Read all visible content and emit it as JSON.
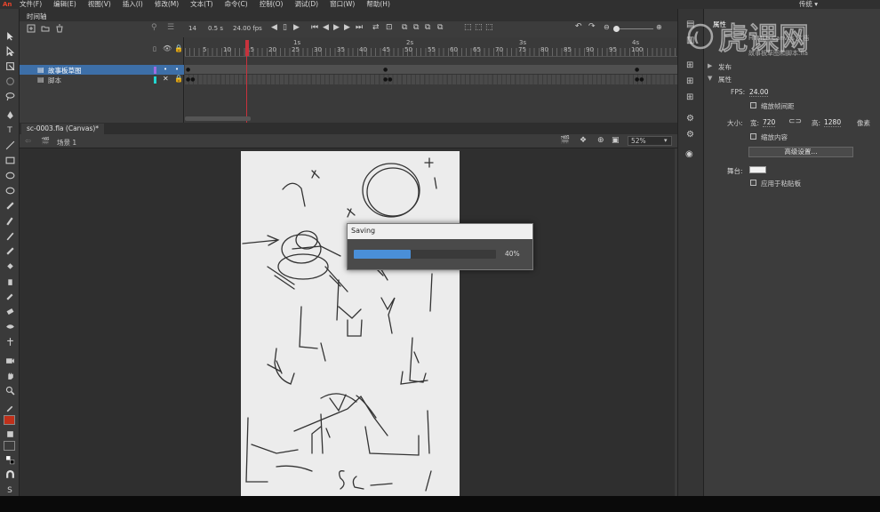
{
  "menubar": {
    "logo": "An",
    "items": [
      "文件(F)",
      "编辑(E)",
      "视图(V)",
      "插入(I)",
      "修改(M)",
      "文本(T)",
      "命令(C)",
      "控制(O)",
      "调试(D)",
      "窗口(W)",
      "帮助(H)"
    ],
    "workspace": "传统 ▾"
  },
  "timeline": {
    "panel_title": "时间轴",
    "frame": "14",
    "time": "0.5 s",
    "fps": "24.00 fps",
    "seconds": [
      "1s",
      "2s",
      "3s",
      "4s"
    ],
    "ruler": [
      "5",
      "10",
      "15",
      "20",
      "25",
      "30",
      "35",
      "40",
      "45",
      "50",
      "55",
      "60",
      "65",
      "70",
      "75",
      "80",
      "85",
      "90",
      "95",
      "100"
    ],
    "layers": [
      {
        "name": "故事板草图",
        "color": "#a16be0",
        "selected": true
      },
      {
        "name": "脚本",
        "color": "#22d6d0",
        "selected": false
      }
    ]
  },
  "document": {
    "tab": "sc-0003.fla (Canvas)*",
    "scene": "场景 1",
    "zoom": "52%"
  },
  "saving_dialog": {
    "title": "Saving",
    "progress": 0.4,
    "percent_label": "40%"
  },
  "properties": {
    "tab": "属性",
    "doc_type": "HTML5 Canvas 文档",
    "doc_file": "故事板草图和脚本.fla",
    "publish": "发布",
    "section": "属性",
    "fps_label": "FPS:",
    "fps_value": "24.00",
    "scale_spacing": "缩放帧间距",
    "size_label": "大小:",
    "width_label": "宽:",
    "width_value": "720",
    "height_label": "高:",
    "height_value": "1280",
    "unit": "像素",
    "scale_content": "缩放内容",
    "advanced_button": "高级设置...",
    "stage_label": "舞台:",
    "apply_pasteboard": "应用于粘贴板"
  },
  "watermark": "虎课网",
  "colors": {
    "layer_selected": "#3d6fa8",
    "playhead": "#c8323c",
    "progress": "#4a8fd8",
    "fill_swatch": "#c0301a"
  }
}
